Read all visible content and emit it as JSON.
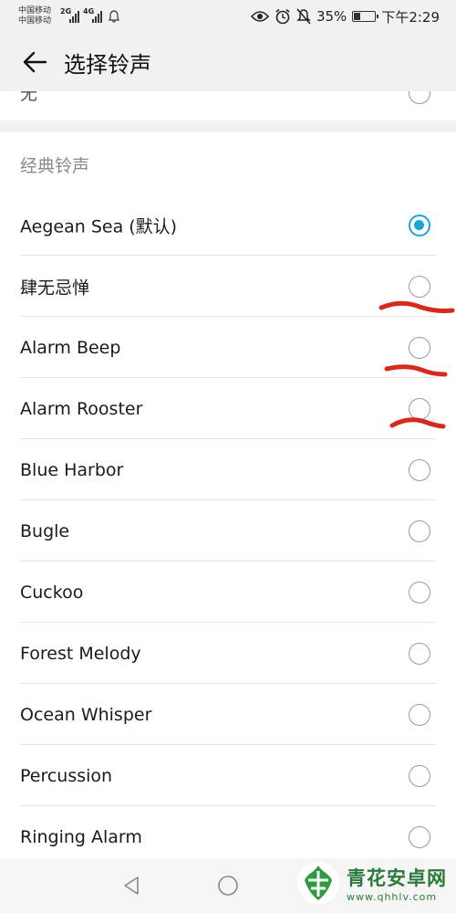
{
  "status_bar": {
    "carrier1": "中国移动",
    "carrier2": "中国移动",
    "sig1_gen": "2G",
    "sig2_gen": "4G",
    "battery_percent": "35%",
    "battery_level": 0.35,
    "time": "下午2:29"
  },
  "app_bar": {
    "title": "选择铃声"
  },
  "top_item": {
    "label": "无"
  },
  "section": {
    "header": "经典铃声",
    "items": [
      {
        "label": "Aegean Sea (默认)",
        "checked": true
      },
      {
        "label": "肆无忌惮",
        "checked": false
      },
      {
        "label": "Alarm Beep",
        "checked": false
      },
      {
        "label": "Alarm Rooster",
        "checked": false
      },
      {
        "label": "Blue Harbor",
        "checked": false
      },
      {
        "label": "Bugle",
        "checked": false
      },
      {
        "label": "Cuckoo",
        "checked": false
      },
      {
        "label": "Forest Melody",
        "checked": false
      },
      {
        "label": "Ocean Whisper",
        "checked": false
      },
      {
        "label": "Percussion",
        "checked": false
      },
      {
        "label": "Ringing Alarm",
        "checked": false
      }
    ]
  },
  "colors": {
    "accent": "#1aa5d9",
    "annotation": "#d62a1e",
    "watermark": "#2c7a3a"
  },
  "watermark": {
    "title": "青花安卓网",
    "url": "www.qhhlv.com"
  }
}
